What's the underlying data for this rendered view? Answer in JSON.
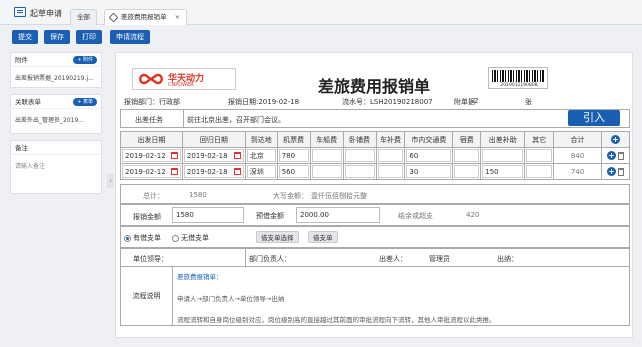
{
  "app": {
    "title": "起草申请"
  },
  "tabs": [
    {
      "label": "全部"
    },
    {
      "label": "差旅费用报销单",
      "close": "×"
    }
  ],
  "toolbar": {
    "submit": "提交",
    "save": "保存",
    "print": "打印",
    "flow": "申请流程"
  },
  "sidebar": {
    "attachments": {
      "title": "附件",
      "add": "+ 附件",
      "item": "出差报销票据_20190219.j..."
    },
    "related": {
      "title": "关联表单",
      "add": "+ 表单",
      "item": "出差外出_管理员_2019..."
    },
    "notes": {
      "title": "备注",
      "placeholder": "请输入备注"
    }
  },
  "form": {
    "logo_cn": "华天动力",
    "logo_en": "CNPOWER",
    "title": "差旅费用报销单",
    "barcode_number": "2019012190808",
    "dept": "报销部门：行政部",
    "date": "报销日期:2019-02-18",
    "serial": "流水号：LSH20190218007",
    "attach_count_label": "附单据",
    "attach_count": "2",
    "attach_unit": "张",
    "task_label": "出差任务",
    "task_value": "前往北京出差，召开部门会议。",
    "import_btn": "引入"
  },
  "detail": {
    "headers": [
      "出发日期",
      "回归日期",
      "到达地",
      "机票费",
      "车船费",
      "卧铺费",
      "车补费",
      "市内交通费",
      "宿费",
      "出差补助",
      "其它",
      "合计"
    ],
    "rows": [
      {
        "start": "2019-02-12",
        "end": "2019-02-18",
        "dest": "北京",
        "air": "780",
        "car": "",
        "sleeper": "",
        "subsidy": "",
        "local": "60",
        "hotel": "",
        "allowance": "",
        "other": "",
        "total": "840"
      },
      {
        "start": "2019-02-12",
        "end": "2019-02-18",
        "dest": "深圳",
        "air": "560",
        "car": "",
        "sleeper": "",
        "subsidy": "",
        "local": "30",
        "hotel": "",
        "allowance": "150",
        "other": "",
        "total": "740"
      }
    ]
  },
  "summary": {
    "total_label": "总计：",
    "total": "1580",
    "caps_label": "大写金额：",
    "caps": "壹仟伍佰捌拾元整",
    "reimb_label": "报销金额",
    "reimb": "1580",
    "prepaid_label": "预借金额",
    "prepaid": "2000.00",
    "balance_label": "结余或超支",
    "balance": "420",
    "radio_yes": "有借支单",
    "radio_no": "无借支单",
    "select_btn": "借支单选择",
    "loan_btn": "借支单",
    "leader_label": "单位领导：",
    "dept_head_label": "部门负责人：",
    "traveler_label": "出差人：",
    "traveler": "管理员",
    "cashier_label": "出纳："
  },
  "process": {
    "label": "流程说明",
    "title": "差旅费报销单：",
    "line1": "申请人→部门负责人→单位领导→出纳",
    "line2": "流程流转和自身岗位级别对应，岗位级别高的直接越过其前面的审批流程向下流转，其他人审批流程以此类推。"
  },
  "colors": {
    "accent": "#1a5fb4",
    "logo": "#d32"
  }
}
